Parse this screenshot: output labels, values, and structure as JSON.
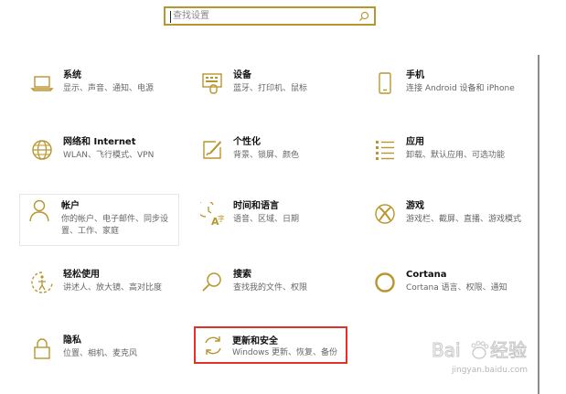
{
  "search": {
    "placeholder": "查找设置"
  },
  "colors": {
    "accent": "#b8962e",
    "selection": "#e0322d",
    "title": "#111111",
    "description": "#666666"
  },
  "tiles": [
    {
      "id": "system",
      "icon": "laptop-icon",
      "title": "系统",
      "desc": "显示、声音、通知、电源"
    },
    {
      "id": "devices",
      "icon": "devices-icon",
      "title": "设备",
      "desc": "蓝牙、打印机、鼠标"
    },
    {
      "id": "phone",
      "icon": "phone-icon",
      "title": "手机",
      "desc": "连接 Android 设备和 iPhone"
    },
    {
      "id": "network",
      "icon": "globe-icon",
      "title": "网络和 Internet",
      "desc": "WLAN、飞行模式、VPN"
    },
    {
      "id": "personalization",
      "icon": "paint-icon",
      "title": "个性化",
      "desc": "背景、锁屏、颜色"
    },
    {
      "id": "apps",
      "icon": "apps-list-icon",
      "title": "应用",
      "desc": "卸载、默认应用、可选功能"
    },
    {
      "id": "accounts",
      "icon": "person-icon",
      "title": "帐户",
      "desc": "你的帐户、电子邮件、同步设置、工作、家庭"
    },
    {
      "id": "time-language",
      "icon": "time-language-icon",
      "title": "时间和语言",
      "desc": "语音、区域、日期"
    },
    {
      "id": "gaming",
      "icon": "xbox-icon",
      "title": "游戏",
      "desc": "游戏栏、截屏、直播、游戏模式"
    },
    {
      "id": "ease-of-access",
      "icon": "ease-of-access-icon",
      "title": "轻松使用",
      "desc": "讲述人、放大镜、高对比度"
    },
    {
      "id": "search",
      "icon": "search-magnifier-icon",
      "title": "搜索",
      "desc": "查找我的文件、权限"
    },
    {
      "id": "cortana",
      "icon": "cortana-icon",
      "title": "Cortana",
      "desc": "Cortana 语言、权限、通知"
    },
    {
      "id": "privacy",
      "icon": "lock-icon",
      "title": "隐私",
      "desc": "位置、相机、麦克风"
    },
    {
      "id": "update-security",
      "icon": "sync-icon",
      "title": "更新和安全",
      "desc": "Windows 更新、恢复、备份"
    }
  ],
  "watermark": {
    "brand": "Bai du 经验",
    "url": "jingyan.baidu.com"
  }
}
